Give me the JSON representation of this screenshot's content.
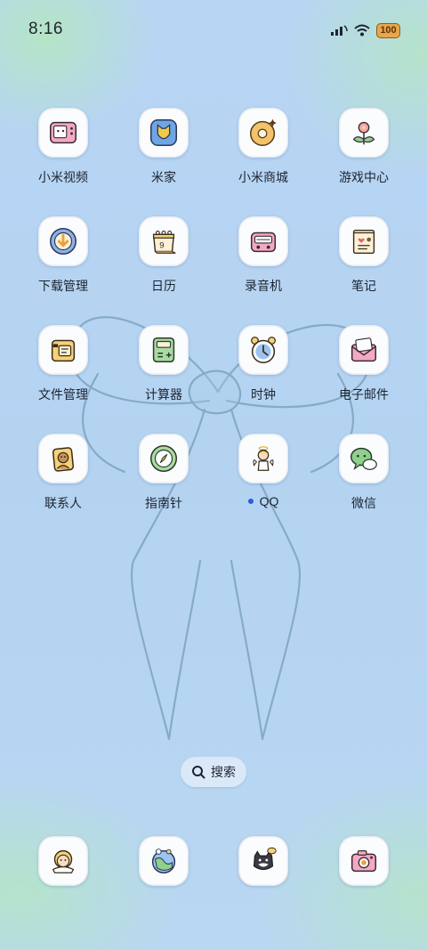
{
  "status_bar": {
    "time": "8:16",
    "battery": "100"
  },
  "apps": [
    {
      "label": "小米视频",
      "icon": "mi-video-icon"
    },
    {
      "label": "米家",
      "icon": "mijia-icon"
    },
    {
      "label": "小米商城",
      "icon": "mi-store-icon"
    },
    {
      "label": "游戏中心",
      "icon": "game-center-icon"
    },
    {
      "label": "下载管理",
      "icon": "download-manager-icon"
    },
    {
      "label": "日历",
      "icon": "calendar-icon"
    },
    {
      "label": "录音机",
      "icon": "recorder-icon"
    },
    {
      "label": "笔记",
      "icon": "notes-icon"
    },
    {
      "label": "文件管理",
      "icon": "file-manager-icon"
    },
    {
      "label": "计算器",
      "icon": "calculator-icon"
    },
    {
      "label": "时钟",
      "icon": "clock-icon"
    },
    {
      "label": "电子邮件",
      "icon": "email-icon"
    },
    {
      "label": "联系人",
      "icon": "contacts-icon"
    },
    {
      "label": "指南针",
      "icon": "compass-icon"
    },
    {
      "label": "QQ",
      "icon": "qq-icon",
      "new_indicator": true
    },
    {
      "label": "微信",
      "icon": "wechat-icon"
    }
  ],
  "search": {
    "label": "搜索"
  },
  "dock": [
    {
      "icon": "phone-icon"
    },
    {
      "icon": "browser-icon"
    },
    {
      "icon": "messages-icon"
    },
    {
      "icon": "camera-icon"
    }
  ],
  "colors": {
    "label_text": "#1d2430",
    "notification_dot": "#2c5be0",
    "battery": "#e9a64a"
  }
}
